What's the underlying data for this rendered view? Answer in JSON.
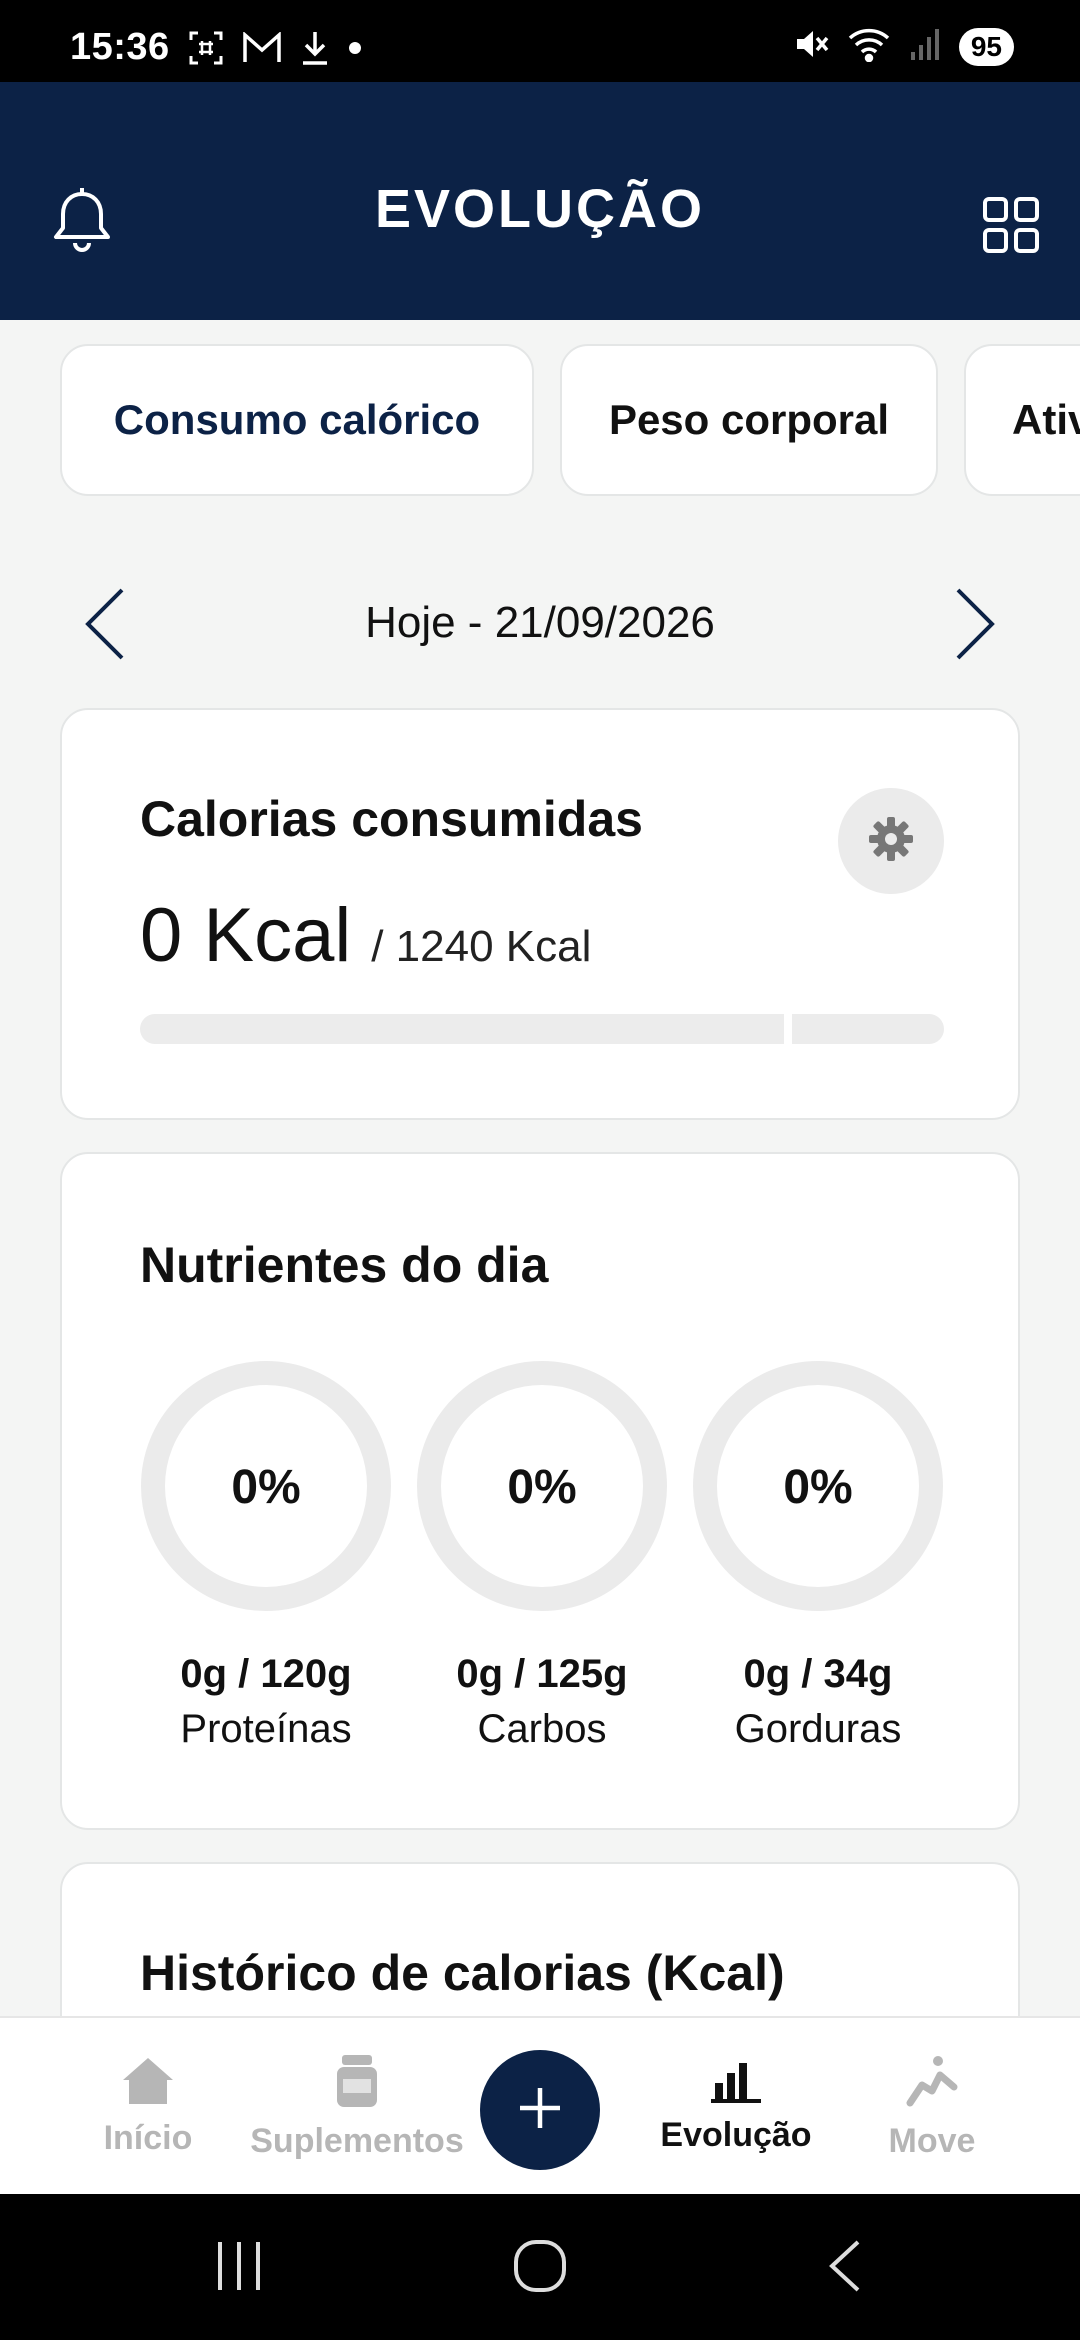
{
  "status_bar": {
    "time": "15:36",
    "left_icons": [
      "screenshot-icon",
      "gmail-icon",
      "download-icon",
      "dot-icon"
    ],
    "right_icons": [
      "mute-icon",
      "wifi-icon",
      "signal-icon"
    ],
    "battery": "95"
  },
  "header": {
    "title": "EVOLUÇÃO",
    "left_icon": "bell-icon",
    "right_icon": "grid-icon",
    "background": "#0c2246"
  },
  "tabs": [
    {
      "label": "Consumo calórico",
      "active": true
    },
    {
      "label": "Peso corporal",
      "active": false
    },
    {
      "label": "Ativ",
      "active": false
    }
  ],
  "date_nav": {
    "label": "Hoje - 21/09/2026",
    "prev_icon": "chevron-left-icon",
    "next_icon": "chevron-right-icon"
  },
  "calories_card": {
    "title": "Calorias consumidas",
    "consumed": "0 Kcal",
    "goal": "/ 1240 Kcal",
    "progress": 0,
    "settings_icon": "gear-icon"
  },
  "nutrients_card": {
    "title": "Nutrientes do dia",
    "items": [
      {
        "percent": "0%",
        "amount": "0g / 120g",
        "name": "Proteínas",
        "progress": 0
      },
      {
        "percent": "0%",
        "amount": "0g / 125g",
        "name": "Carbos",
        "progress": 0
      },
      {
        "percent": "0%",
        "amount": "0g / 34g",
        "name": "Gorduras",
        "progress": 0
      }
    ]
  },
  "history_card": {
    "title": "Histórico de calorias (Kcal)"
  },
  "bottom_nav": {
    "items": [
      {
        "label": "Início",
        "icon": "home-icon",
        "active": false
      },
      {
        "label": "Suplementos",
        "icon": "supplement-jar-icon",
        "active": false
      },
      {
        "label": "Evolução",
        "icon": "bar-chart-icon",
        "active": true
      },
      {
        "label": "Move",
        "icon": "running-person-icon",
        "active": false
      }
    ],
    "fab_icon": "plus-icon"
  },
  "system_nav": {
    "icons": [
      "recents-icon",
      "home-circle-icon",
      "back-icon"
    ]
  }
}
